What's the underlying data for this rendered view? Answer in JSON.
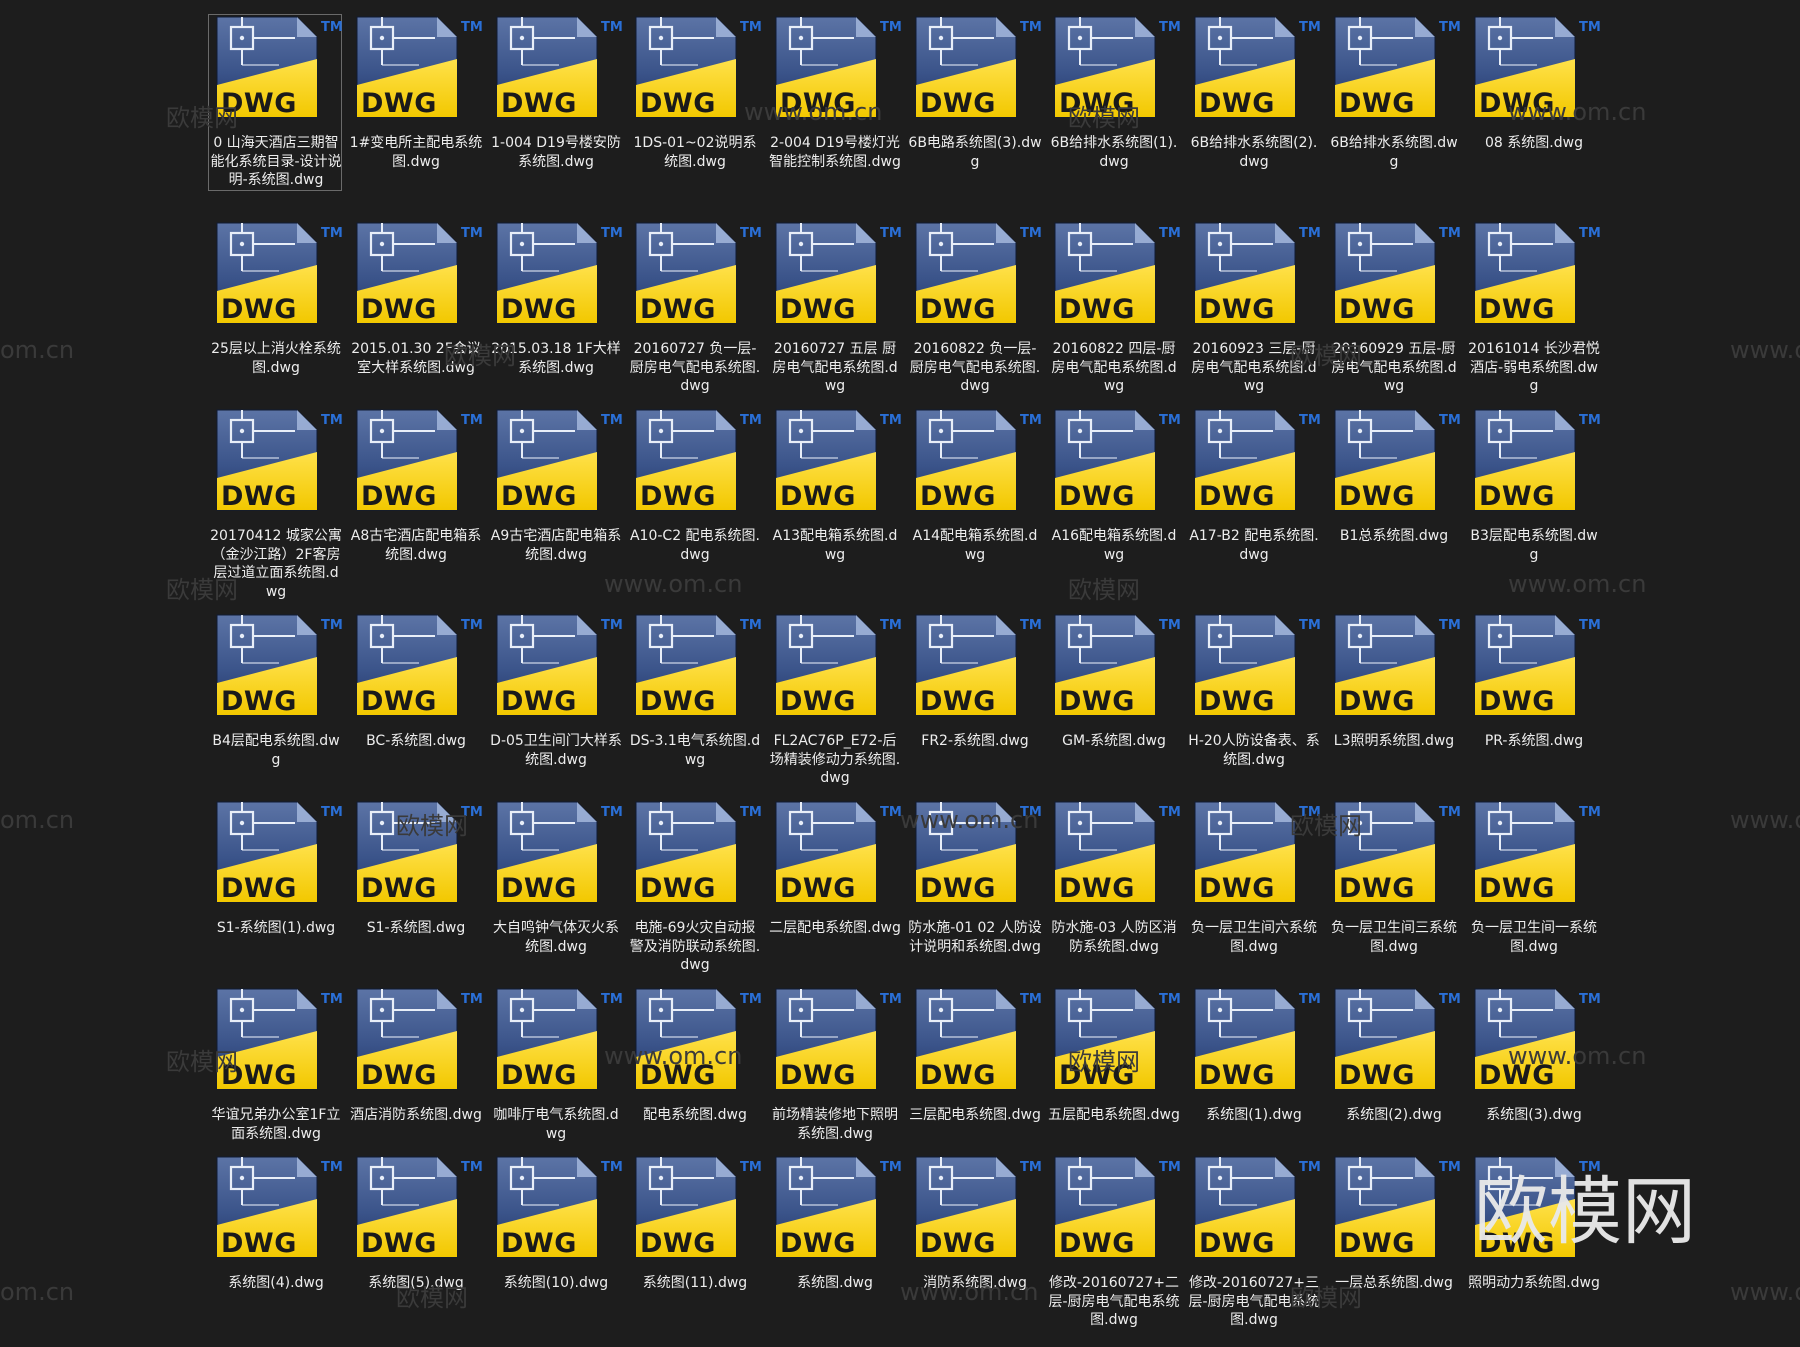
{
  "files": [
    "0 山海天酒店三期智能化系统目录-设计说明-系统图.dwg",
    "1#变电所主配电系统图.dwg",
    "1-004 D19号楼安防系统图.dwg",
    "1DS-01~02说明系统图.dwg",
    "2-004 D19号楼灯光智能控制系统图.dwg",
    "6B电路系统图(3).dwg",
    "6B给排水系统图(1).dwg",
    "6B给排水系统图(2).dwg",
    "6B给排水系统图.dwg",
    "08 系统图.dwg",
    "25层以上消火栓系统图.dwg",
    "2015.01.30 2F会议室大样系统图.dwg",
    "2015.03.18 1F大样系统图.dwg",
    "20160727 负一层-厨房电气配电系统图.dwg",
    "20160727 五层 厨房电气配电系统图.dwg",
    "20160822 负一层-厨房电气配电系统图.dwg",
    "20160822 四层-厨房电气配电系统图.dwg",
    "20160923 三层-厨房电气配电系统图.dwg",
    "20160929 五层-厨房电气配电系统图.dwg",
    "20161014 长沙君悦酒店-弱电系统图.dwg",
    "20170412 城家公寓（金沙江路）2F客房层过道立面系统图.dwg",
    "A8古宅酒店配电箱系统图.dwg",
    "A9古宅酒店配电箱系统图.dwg",
    "A10-C2 配电系统图.dwg",
    "A13配电箱系统图.dwg",
    "A14配电箱系统图.dwg",
    "A16配电箱系统图.dwg",
    "A17-B2 配电系统图.dwg",
    "B1总系统图.dwg",
    "B3层配电系统图.dwg",
    "B4层配电系统图.dwg",
    "BC-系统图.dwg",
    "D-05卫生间门大样系统图.dwg",
    "DS-3.1电气系统图.dwg",
    "FL2AC76P_E72-后场精装修动力系统图.dwg",
    "FR2-系统图.dwg",
    "GM-系统图.dwg",
    "H-20人防设备表、系统图.dwg",
    "L3照明系统图.dwg",
    "PR-系统图.dwg",
    "S1-系统图(1).dwg",
    "S1-系统图.dwg",
    "大自鸣钟气体灭火系统图.dwg",
    "电施-69火灾自动报警及消防联动系统图.dwg",
    "二层配电系统图.dwg",
    "防水施-01 02 人防设计说明和系统图.dwg",
    "防水施-03 人防区消防系统图.dwg",
    "负一层卫生间六系统图.dwg",
    "负一层卫生间三系统图.dwg",
    "负一层卫生间一系统图.dwg",
    "华谊兄弟办公室1F立面系统图.dwg",
    "酒店消防系统图.dwg",
    "咖啡厅电气系统图.dwg",
    "配电系统图.dwg",
    "前场精装修地下照明系统图.dwg",
    "三层配电系统图.dwg",
    "五层配电系统图.dwg",
    "系统图(1).dwg",
    "系统图(2).dwg",
    "系统图(3).dwg",
    "系统图(4).dwg",
    "系统图(5).dwg",
    "系统图(10).dwg",
    "系统图(11).dwg",
    "系统图.dwg",
    "消防系统图.dwg",
    "修改-20160727+二层-厨房电气配电系统图.dwg",
    "修改-20160727+三层-厨房电气配电系统图.dwg",
    "一层总系统图.dwg",
    "照明动力系统图.dwg"
  ],
  "icon": {
    "type_label": "DWG",
    "tm_label": "TM",
    "icon_name": "dwg-file-icon"
  },
  "selected_index": 0,
  "watermarks": {
    "url": "www.om.cn",
    "url_short": "om.cn",
    "brand": "欧模网"
  },
  "colors": {
    "background": "#1d1d1d",
    "label_text": "#ededed",
    "icon_blue_dark": "#1f3466",
    "icon_blue_light": "#5c74a6",
    "icon_yellow": "#f2c800",
    "selection_border": "#6a6a6a"
  }
}
